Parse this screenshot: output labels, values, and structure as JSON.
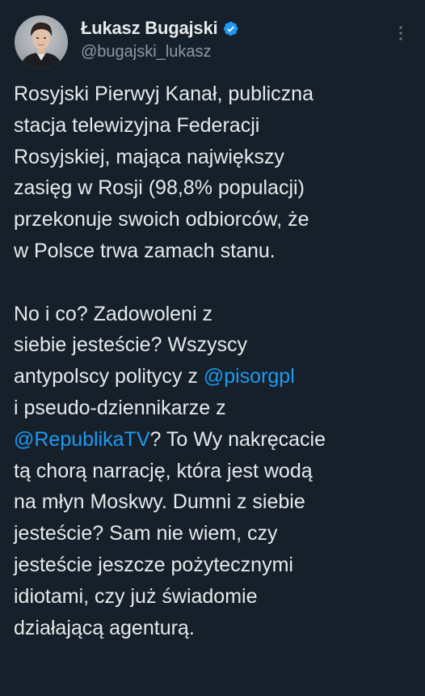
{
  "author": {
    "display_name": "Łukasz Bugajski",
    "handle": "@bugajski_lukasz"
  },
  "icons": {
    "verified": "verified-badge-icon",
    "more": "more-options-icon"
  },
  "colors": {
    "background": "#15202b",
    "text": "#e7e9ea",
    "secondary_text": "#8b98a5",
    "mention": "#1d9bf0",
    "verified": "#1d9bf0"
  },
  "tweet": {
    "paragraph1": [
      "Rosyjski Pierwyj Kanał, publiczna",
      "stacja telewizyjna Federacji",
      "Rosyjskiej, mająca największy",
      "zasięg w Rosji (98,8% populacji)",
      "przekonuje swoich odbiorców, że",
      "w Polsce trwa zamach stanu."
    ],
    "p2_l1": "No i co? Zadowoleni z",
    "p2_l2": "siebie jesteście? Wszyscy",
    "p2_l3_pre": "antypolscy politycy z ",
    "mention1": "@pisorgpl",
    "p2_l4": "i pseudo-dziennikarze z",
    "mention2": "@RepublikaTV",
    "p2_l5_post": "? To Wy nakręcacie",
    "p2_rest": [
      "tą chorą narrację, która jest wodą",
      "na młyn Moskwy. Dumni z siebie",
      "jesteście? Sam nie wiem, czy",
      "jesteście jeszcze pożytecznymi",
      "idiotami, czy już świadomie",
      "działającą agenturą."
    ]
  }
}
